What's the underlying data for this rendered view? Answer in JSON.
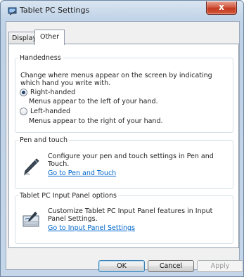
{
  "window": {
    "title": "Tablet PC Settings",
    "close_label": "x"
  },
  "tabs": [
    {
      "label": "Display"
    },
    {
      "label": "Other"
    }
  ],
  "handedness": {
    "legend": "Handedness",
    "description": "Change where menus appear on the screen by indicating which hand you write with.",
    "options": [
      {
        "label": "Right-handed",
        "sub": "Menus appear to the left of your hand.",
        "checked": true
      },
      {
        "label": "Left-handed",
        "sub": "Menus appear to the right of your hand.",
        "checked": false
      }
    ]
  },
  "pen_touch": {
    "legend": "Pen and touch",
    "text": "Configure your pen and touch settings in Pen and Touch.",
    "link": "Go to Pen and Touch",
    "icon": "pen-icon"
  },
  "input_panel": {
    "legend": "Tablet PC Input Panel options",
    "text": "Customize Tablet PC Input Panel features in Input Panel Settings.",
    "link": "Go to Input Panel Settings",
    "icon": "input-panel-icon"
  },
  "buttons": {
    "ok": "OK",
    "cancel": "Cancel",
    "apply": "Apply"
  }
}
